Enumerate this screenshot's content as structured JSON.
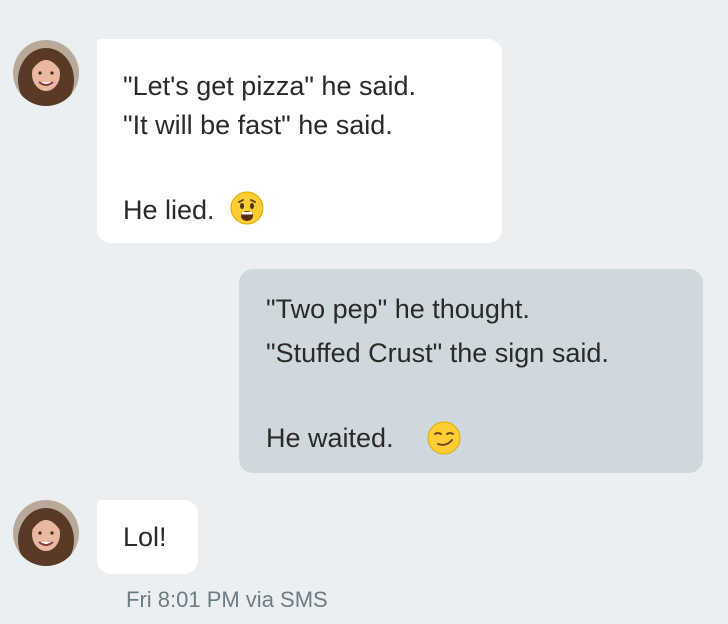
{
  "conversation": {
    "messages": [
      {
        "direction": "incoming",
        "lines": [
          "\"Let's get pizza\" he said.",
          "\"It will be fast\" he said.",
          "",
          "He lied."
        ],
        "emoji": "anguished-face-emoji"
      },
      {
        "direction": "outgoing",
        "lines": [
          "\"Two pep\" he thought.",
          "\"Stuffed Crust\" the sign said.",
          "",
          "He waited."
        ],
        "emoji": "smirking-face-emoji"
      },
      {
        "direction": "incoming",
        "lines": [
          "Lol!"
        ]
      }
    ],
    "last_message_meta": "Fri 8:01 PM via SMS"
  },
  "colors": {
    "background": "#eceff1",
    "incoming_bubble": "#ffffff",
    "outgoing_bubble": "#cfd8dc",
    "text": "#2a2a2a",
    "meta_text": "#6b7c85"
  }
}
